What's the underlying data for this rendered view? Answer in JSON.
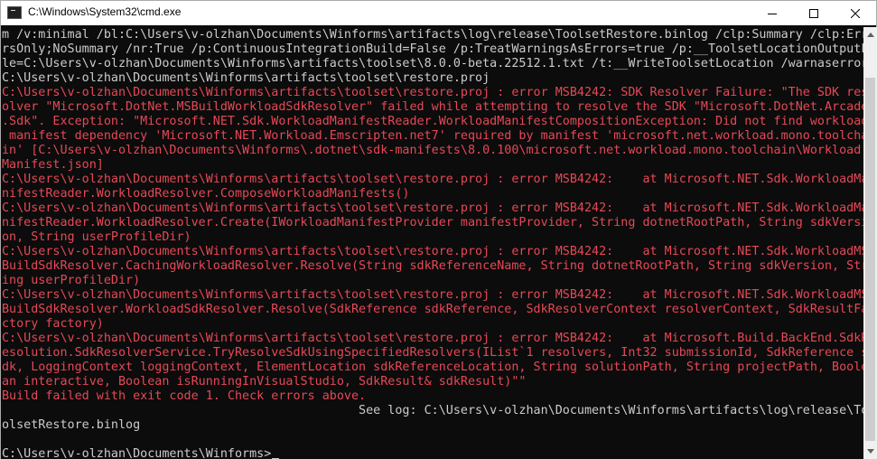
{
  "window": {
    "title": "C:\\Windows\\System32\\cmd.exe",
    "icon": "cmd-icon",
    "buttons": {
      "minimize": "minimize-icon",
      "maximize": "maximize-icon",
      "close": "close-icon"
    }
  },
  "console": {
    "colors": {
      "background": "#0c0c0c",
      "text": "#cccccc",
      "error": "#e74856"
    },
    "lines": [
      {
        "text": "m /v:minimal /bl:C:\\Users\\v-olzhan\\Documents\\Winforms\\artifacts\\log\\release\\ToolsetRestore.binlog /clp:Summary /clp:Erro",
        "type": "normal"
      },
      {
        "text": "rsOnly;NoSummary /nr:True /p:ContinuousIntegrationBuild=False /p:TreatWarningsAsErrors=true /p:__ToolsetLocationOutputFi",
        "type": "normal"
      },
      {
        "text": "le=C:\\Users\\v-olzhan\\Documents\\Winforms\\artifacts\\toolset\\8.0.0-beta.22512.1.txt /t:__WriteToolsetLocation /warnaserror",
        "type": "normal"
      },
      {
        "text": "C:\\Users\\v-olzhan\\Documents\\Winforms\\artifacts\\toolset\\restore.proj",
        "type": "normal"
      },
      {
        "text": "C:\\Users\\v-olzhan\\Documents\\Winforms\\artifacts\\toolset\\restore.proj : error MSB4242: SDK Resolver Failure: \"The SDK res",
        "type": "error"
      },
      {
        "text": "olver \"Microsoft.DotNet.MSBuildWorkloadSdkResolver\" failed while attempting to resolve the SDK \"Microsoft.DotNet.Arcade",
        "type": "error"
      },
      {
        "text": ".Sdk\". Exception: \"Microsoft.NET.Sdk.WorkloadManifestReader.WorkloadManifestCompositionException: Did not find workload",
        "type": "error"
      },
      {
        "text": " manifest dependency 'Microsoft.NET.Workload.Emscripten.net7' required by manifest 'microsoft.net.workload.mono.toolcha",
        "type": "error"
      },
      {
        "text": "in' [C:\\Users\\v-olzhan\\Documents\\Winforms\\.dotnet\\sdk-manifests\\8.0.100\\microsoft.net.workload.mono.toolchain\\Workload",
        "type": "error"
      },
      {
        "text": "Manifest.json]",
        "type": "error"
      },
      {
        "text": "C:\\Users\\v-olzhan\\Documents\\Winforms\\artifacts\\toolset\\restore.proj : error MSB4242:    at Microsoft.NET.Sdk.WorkloadMa",
        "type": "error"
      },
      {
        "text": "nifestReader.WorkloadResolver.ComposeWorkloadManifests()",
        "type": "error"
      },
      {
        "text": "C:\\Users\\v-olzhan\\Documents\\Winforms\\artifacts\\toolset\\restore.proj : error MSB4242:    at Microsoft.NET.Sdk.WorkloadMa",
        "type": "error"
      },
      {
        "text": "nifestReader.WorkloadResolver.Create(IWorkloadManifestProvider manifestProvider, String dotnetRootPath, String sdkVersi",
        "type": "error"
      },
      {
        "text": "on, String userProfileDir)",
        "type": "error"
      },
      {
        "text": "C:\\Users\\v-olzhan\\Documents\\Winforms\\artifacts\\toolset\\restore.proj : error MSB4242:    at Microsoft.NET.Sdk.WorkloadMS",
        "type": "error"
      },
      {
        "text": "BuildSdkResolver.CachingWorkloadResolver.Resolve(String sdkReferenceName, String dotnetRootPath, String sdkVersion, Str",
        "type": "error"
      },
      {
        "text": "ing userProfileDir)",
        "type": "error"
      },
      {
        "text": "C:\\Users\\v-olzhan\\Documents\\Winforms\\artifacts\\toolset\\restore.proj : error MSB4242:    at Microsoft.NET.Sdk.WorkloadMS",
        "type": "error"
      },
      {
        "text": "BuildSdkResolver.WorkloadSdkResolver.Resolve(SdkReference sdkReference, SdkResolverContext resolverContext, SdkResultFa",
        "type": "error"
      },
      {
        "text": "ctory factory)",
        "type": "error"
      },
      {
        "text": "C:\\Users\\v-olzhan\\Documents\\Winforms\\artifacts\\toolset\\restore.proj : error MSB4242:    at Microsoft.Build.BackEnd.SdkR",
        "type": "error"
      },
      {
        "text": "esolution.SdkResolverService.TryResolveSdkUsingSpecifiedResolvers(IList`1 resolvers, Int32 submissionId, SdkReference s",
        "type": "error"
      },
      {
        "text": "dk, LoggingContext loggingContext, ElementLocation sdkReferenceLocation, String solutionPath, String projectPath, Boole",
        "type": "error"
      },
      {
        "text": "an interactive, Boolean isRunningInVisualStudio, SdkResult& sdkResult)\"\"",
        "type": "error"
      },
      {
        "text": "Build failed with exit code 1. Check errors above.",
        "type": "error"
      },
      {
        "text": "                                                 See log: C:\\Users\\v-olzhan\\Documents\\Winforms\\artifacts\\log\\release\\To",
        "type": "normal"
      },
      {
        "text": "olsetRestore.binlog",
        "type": "normal"
      },
      {
        "text": "",
        "type": "normal"
      },
      {
        "text": "C:\\Users\\v-olzhan\\Documents\\Winforms>",
        "type": "prompt"
      }
    ]
  },
  "scrollbar": {
    "up_icon": "scroll-up-arrow-icon",
    "down_icon": "scroll-down-arrow-icon"
  }
}
